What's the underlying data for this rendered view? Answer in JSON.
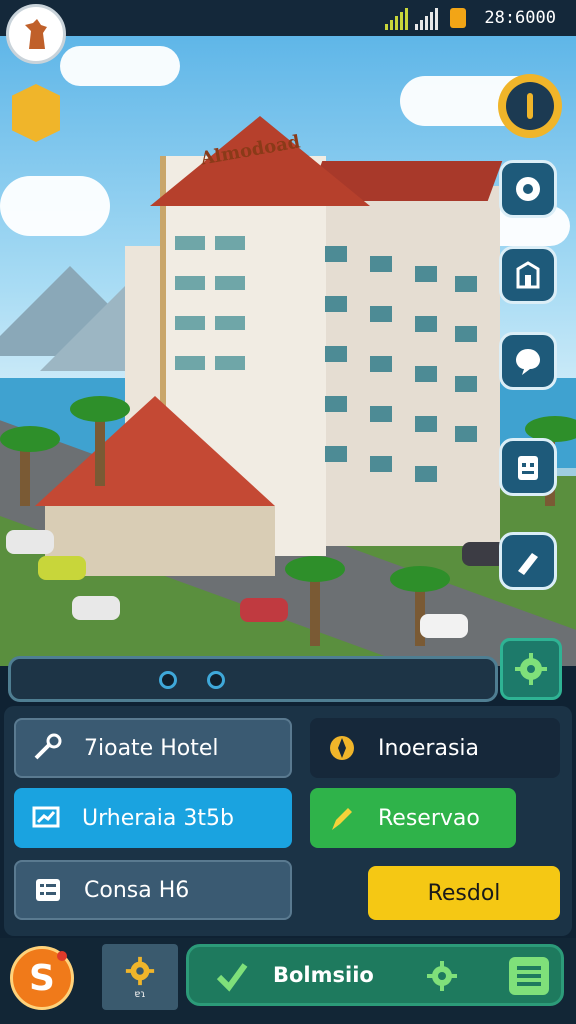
{
  "status_bar": {
    "time": "28:6000"
  },
  "hotel": {
    "sign": "Almodoad"
  },
  "panel": {
    "buttons": [
      {
        "label": "7ioate Hotel",
        "icon": "tools-icon"
      },
      {
        "label": "Inoerasia",
        "icon": "compass-icon"
      },
      {
        "label": "Urheraia 3t5b",
        "icon": "chart-icon"
      },
      {
        "label": "Reservao",
        "icon": "brush-icon"
      },
      {
        "label": "Consa H6",
        "icon": "list-icon"
      },
      {
        "label": "Resdol",
        "icon": ""
      }
    ]
  },
  "pager": {
    "pages": 2
  },
  "bottom_nav": {
    "coin_symbol": "S",
    "tab_caption": "ɐɿ",
    "bar_label": "Bolmsiio"
  },
  "colors": {
    "accent_blue": "#1aa3e0",
    "accent_green": "#2fb34a",
    "accent_yellow": "#f5c814",
    "panel_dark": "#1b3346"
  }
}
